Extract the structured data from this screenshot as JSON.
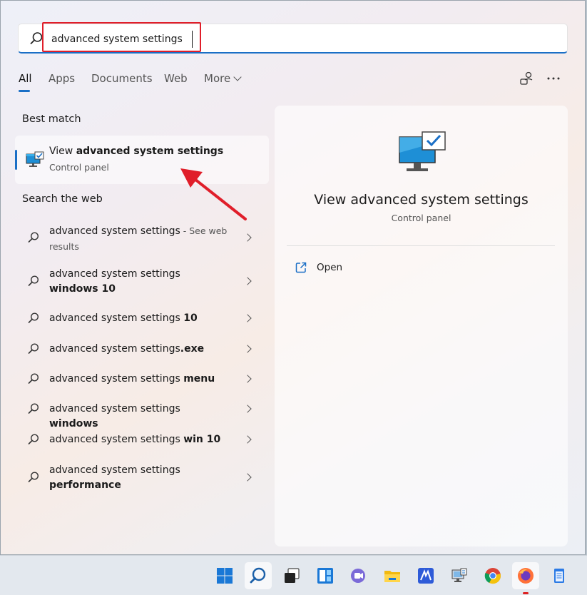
{
  "search": {
    "query": "advanced system settings"
  },
  "tabs": [
    {
      "label": "All"
    },
    {
      "label": "Apps"
    },
    {
      "label": "Documents"
    },
    {
      "label": "Web"
    },
    {
      "label": "More"
    }
  ],
  "best_match": {
    "section_title": "Best match",
    "title_prefix": "View ",
    "title_bold": "advanced system settings",
    "subtitle": "Control panel",
    "icon": "monitor-check-icon"
  },
  "web": {
    "section_title": "Search the web",
    "items": [
      {
        "prefix": "advanced system settings",
        "bold": "",
        "suffix": " - See web results"
      },
      {
        "prefix": "advanced system settings ",
        "bold": "windows 10",
        "suffix": ""
      },
      {
        "prefix": "advanced system settings ",
        "bold": "10",
        "suffix": ""
      },
      {
        "prefix": "advanced system settings",
        "bold": ".exe",
        "suffix": ""
      },
      {
        "prefix": "advanced system settings ",
        "bold": "menu",
        "suffix": ""
      },
      {
        "prefix": "advanced system settings ",
        "bold": "windows",
        "suffix": ""
      },
      {
        "prefix": "advanced system settings ",
        "bold": "win 10",
        "suffix": ""
      },
      {
        "prefix": "advanced system settings ",
        "bold": "performance",
        "suffix": ""
      }
    ]
  },
  "preview": {
    "title": "View advanced system settings",
    "subtitle": "Control panel",
    "action_open": "Open"
  },
  "colors": {
    "accent": "#1a6fc6",
    "highlight": "#e01e2a"
  },
  "taskbar": {
    "icons": [
      "windows-start-icon",
      "search-icon",
      "task-view-icon",
      "widgets-icon",
      "teams-chat-icon",
      "file-explorer-icon",
      "app-icon",
      "control-panel-icon",
      "chrome-icon",
      "firefox-icon",
      "notepad-icon"
    ]
  }
}
